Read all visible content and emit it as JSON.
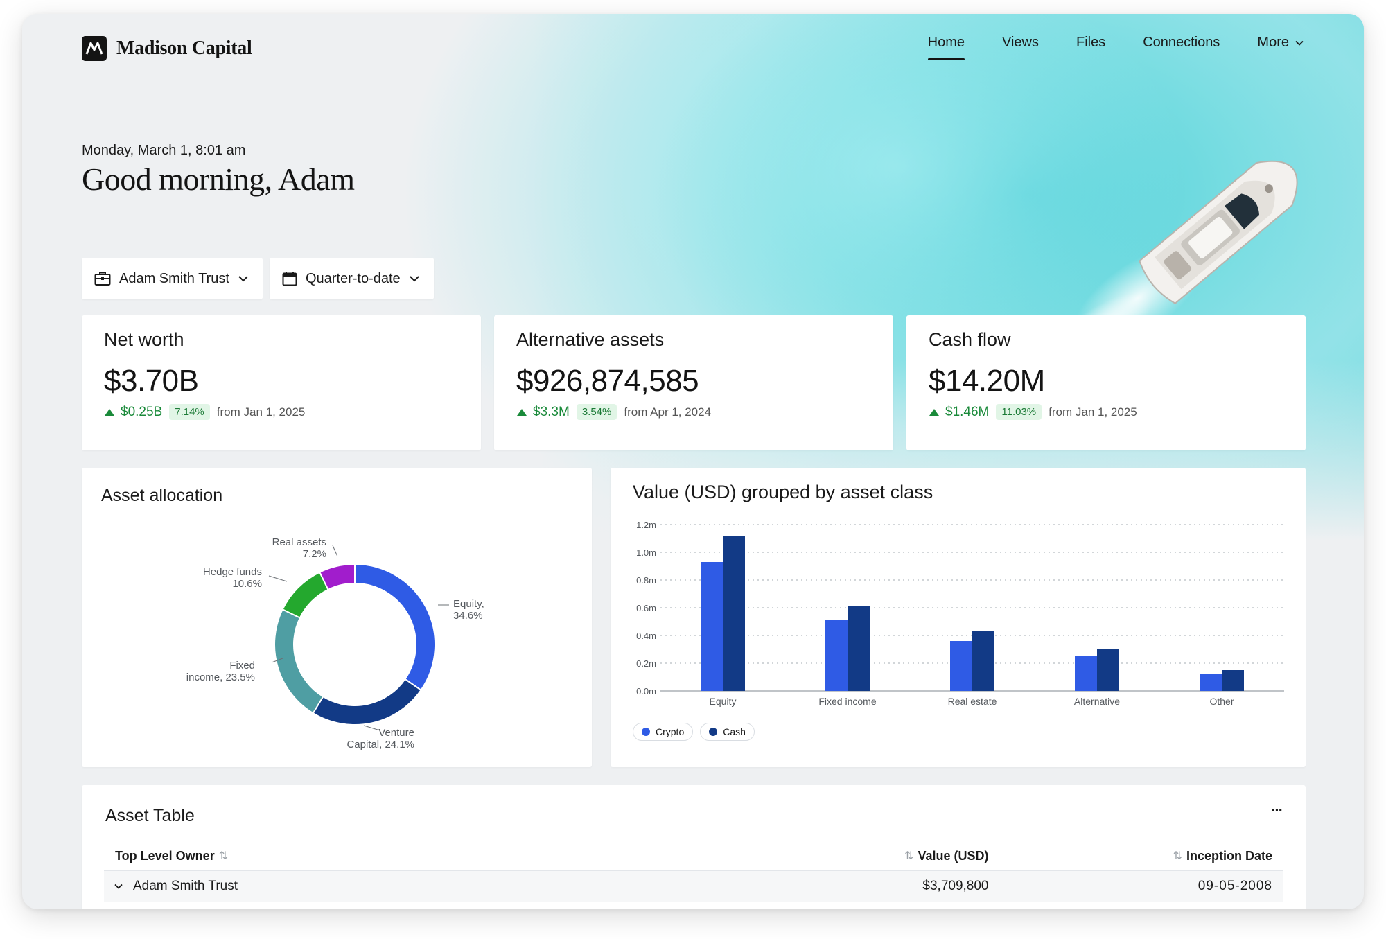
{
  "brand": {
    "name": "Madison Capital"
  },
  "nav": {
    "items": [
      {
        "label": "Home",
        "active": true
      },
      {
        "label": "Views",
        "active": false
      },
      {
        "label": "Files",
        "active": false
      },
      {
        "label": "Connections",
        "active": false
      },
      {
        "label": "More",
        "active": false
      }
    ]
  },
  "greeting": {
    "date": "Monday, March 1, 8:01 am",
    "title": "Good morning, Adam"
  },
  "filters": {
    "entity": "Adam Smith Trust",
    "period": "Quarter-to-date"
  },
  "kpis": [
    {
      "title": "Net worth",
      "value": "$3.70B",
      "change": "$0.25B",
      "pct": "7.14%",
      "from": "from Jan 1, 2025"
    },
    {
      "title": "Alternative assets",
      "value": "$926,874,585",
      "change": "$3.3M",
      "pct": "3.54%",
      "from": "from Apr 1, 2024"
    },
    {
      "title": "Cash flow",
      "value": "$14.20M",
      "change": "$1.46M",
      "pct": "11.03%",
      "from": "from Jan 1, 2025"
    }
  ],
  "allocation": {
    "title": "Asset allocation"
  },
  "bar_chart": {
    "title": "Value (USD) grouped by asset class"
  },
  "chart_data": [
    {
      "type": "pie",
      "title": "Asset allocation",
      "donut": true,
      "categories": [
        "Equity",
        "Venture Capital",
        "Fixed income",
        "Hedge funds",
        "Real assets"
      ],
      "values": [
        34.6,
        24.1,
        23.5,
        10.6,
        7.2
      ],
      "labels": [
        [
          "Equity,",
          "34.6%"
        ],
        [
          "Venture",
          "Capital, 24.1%"
        ],
        [
          "Fixed",
          "income, 23.5%"
        ],
        [
          "Hedge funds",
          "10.6%"
        ],
        [
          "Real assets",
          "7.2%"
        ]
      ],
      "colors": [
        "#2f5be5",
        "#123a86",
        "#4f9ea3",
        "#24a82e",
        "#a11dcc"
      ]
    },
    {
      "type": "bar",
      "title": "Value (USD) grouped by asset class",
      "categories": [
        "Equity",
        "Fixed income",
        "Real estate",
        "Alternative",
        "Other"
      ],
      "series": [
        {
          "name": "Crypto",
          "values": [
            0.93,
            0.51,
            0.36,
            0.25,
            0.12
          ],
          "color": "#2f5be5"
        },
        {
          "name": "Cash",
          "values": [
            1.12,
            0.61,
            0.43,
            0.3,
            0.15
          ],
          "color": "#123a86"
        }
      ],
      "yticks": [
        "0.0m",
        "0.2m",
        "0.4m",
        "0.6m",
        "0.8m",
        "1.0m",
        "1.2m"
      ],
      "ylim": [
        0,
        1.2
      ],
      "grid": true
    }
  ],
  "asset_table": {
    "title": "Asset Table",
    "more_label": "···",
    "columns": [
      "Top Level Owner",
      "Value (USD)",
      "Inception Date"
    ],
    "rows": [
      {
        "owner": "Adam Smith Trust",
        "value": "$3,709,800",
        "date": "09-05-2008"
      }
    ]
  }
}
